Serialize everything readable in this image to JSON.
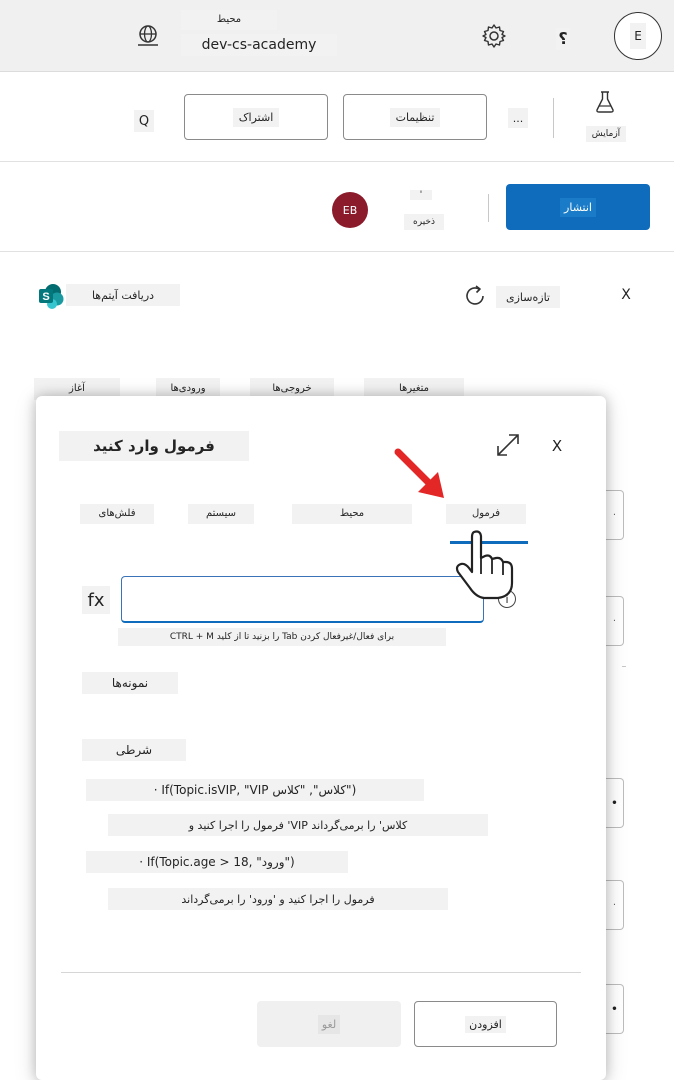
{
  "topbar": {
    "env_label": "محیط",
    "env_name": "dev-cs-academy",
    "help_label": "؟",
    "user_initial": "E"
  },
  "toolbar": {
    "search_label": "Q",
    "share_label": "اشتراک",
    "settings_label": "تنظیمات",
    "more_label": "...",
    "test_label": "آزمایش"
  },
  "publish_row": {
    "publish_label": "انتشار",
    "dot_label": "'",
    "saved_label": "ذخیره",
    "avatar_initials": "EB"
  },
  "panel": {
    "title": "دریافت آیتم‌ها",
    "refresh_label": "تازه‌سازی",
    "close_label": "X"
  },
  "bg_tabs": [
    "آغاز",
    "ورودی‌ها",
    "خروجی‌ها",
    "متغیرها"
  ],
  "dialog": {
    "title": "فرمول وارد کنید",
    "close_label": "X",
    "tabs": [
      "فرمول",
      "محیط",
      "سیستم",
      "فلش‌های"
    ],
    "fx_label": "fx",
    "input_value": "",
    "hint": "CTRL + M را بزنید تا از کلید Tab برای فعال/غیرفعال کردن",
    "examples_heading": "نمونه‌ها",
    "condition_heading": "شرطی",
    "examples": [
      {
        "code": "· If(Topic.isVIP, \"VIP کلاس\", \"کلاس\")",
        "desc": "فرمول را اجرا کنید و 'VIP کلاس' را برمی‌گرداند"
      },
      {
        "code": "· If(Topic.age > 18, \"ورود\")",
        "desc": "فرمول را اجرا کنید و 'ورود' را برمی‌گرداند"
      }
    ],
    "ok_label": "افزودن",
    "cancel_label": "لغو"
  }
}
